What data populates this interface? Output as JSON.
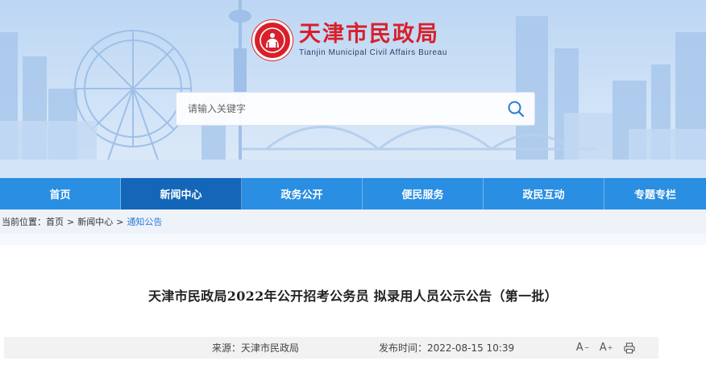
{
  "header": {
    "title_cn": "天津市民政局",
    "title_en": "Tianjin Municipal Civil Affairs Bureau",
    "logo_icon": "civil-affairs-emblem-icon",
    "brand_color": "#d7202a"
  },
  "search": {
    "placeholder": "请输入关键字",
    "icon": "search-icon"
  },
  "nav": {
    "background": "#2a8ee2",
    "active_background": "#1466b8",
    "items": [
      {
        "label": "首页"
      },
      {
        "label": "新闻中心"
      },
      {
        "label": "政务公开"
      },
      {
        "label": "便民服务"
      },
      {
        "label": "政民互动"
      },
      {
        "label": "专题专栏"
      }
    ],
    "active_index": 1
  },
  "breadcrumb": {
    "prefix": "当前位置：",
    "items": [
      "首页",
      "新闻中心",
      "通知公告"
    ],
    "separator": ">"
  },
  "article": {
    "title": "天津市民政局2022年公开招考公务员 拟录用人员公示公告（第一批）",
    "source": "来源：天津市民政局",
    "published": "发布时间：2022-08-15 10:39",
    "tools": {
      "font_decrease_icon": "font-size-decrease-icon",
      "font_increase_icon": "font-size-increase-icon",
      "print_icon": "print-icon"
    }
  }
}
